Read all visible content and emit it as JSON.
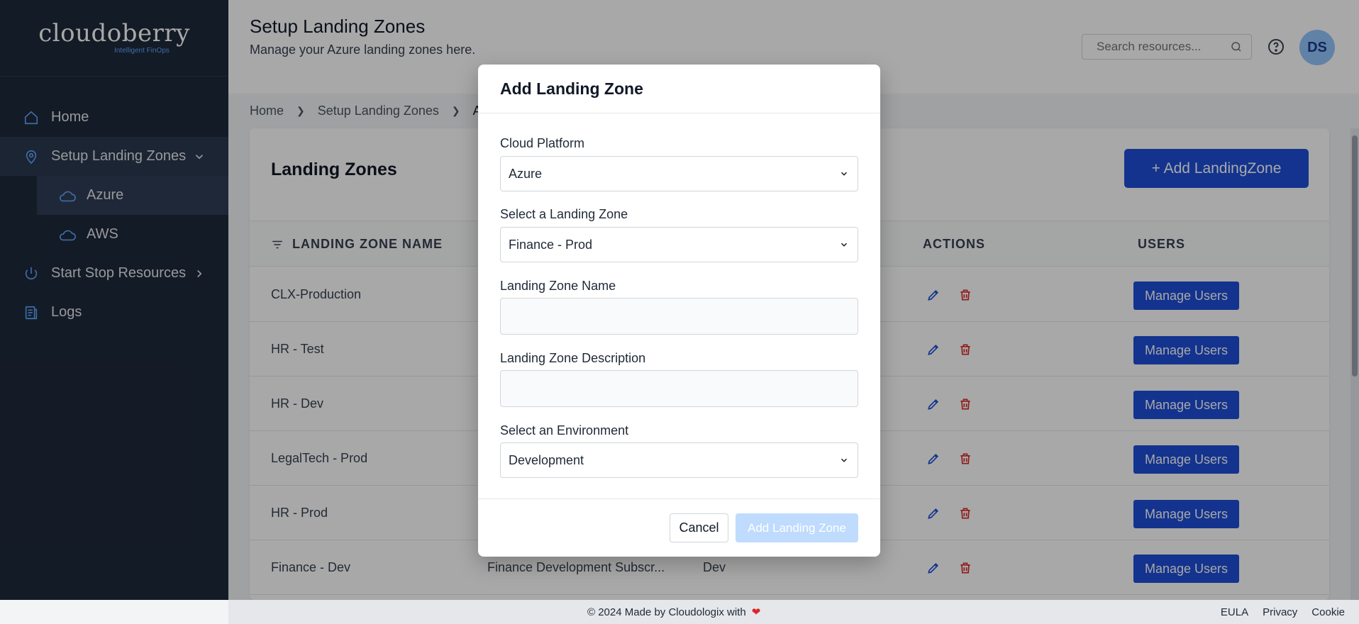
{
  "app": {
    "logo": "cloudoberry",
    "logo_tagline": "Intelligent FinOps"
  },
  "sidebar": {
    "items": [
      {
        "label": "Home",
        "icon": "home-icon"
      },
      {
        "label": "Setup Landing Zones",
        "icon": "map-pin-icon",
        "expanded": true
      },
      {
        "label": "Azure",
        "icon": "cloud-icon",
        "active": true
      },
      {
        "label": "AWS",
        "icon": "cloud-icon"
      },
      {
        "label": "Start Stop Resources",
        "icon": "power-icon"
      },
      {
        "label": "Logs",
        "icon": "logs-icon"
      }
    ]
  },
  "header": {
    "title": "Setup Landing Zones",
    "subtitle": "Manage your Azure landing zones here.",
    "search_placeholder": "Search resources...",
    "avatar_initials": "DS"
  },
  "breadcrumb": {
    "items": [
      "Home",
      "Setup Landing Zones",
      "Azu"
    ]
  },
  "card": {
    "title": "Landing Zones",
    "add_button": "+ Add LandingZone",
    "columns": {
      "name": "LANDING ZONE NAME",
      "actions": "ACTIONS",
      "users": "USERS"
    },
    "rows": [
      {
        "name": "CLX-Production",
        "description": "",
        "environment": ""
      },
      {
        "name": "HR - Test",
        "description": "",
        "environment": ""
      },
      {
        "name": "HR - Dev",
        "description": "",
        "environment": ""
      },
      {
        "name": "LegalTech - Prod",
        "description": "",
        "environment": ""
      },
      {
        "name": "HR - Prod",
        "description": "",
        "environment": ""
      },
      {
        "name": "Finance - Dev",
        "description": "Finance Development Subscr...",
        "environment": "Dev"
      }
    ],
    "manage_users_label": "Manage Users"
  },
  "modal": {
    "title": "Add Landing Zone",
    "cloud_platform_label": "Cloud Platform",
    "cloud_platform_value": "Azure",
    "landing_zone_label": "Select a Landing Zone",
    "landing_zone_value": "Finance - Prod",
    "name_label": "Landing Zone Name",
    "name_value": "",
    "description_label": "Landing Zone Description",
    "description_value": "",
    "environment_label": "Select an Environment",
    "environment_value": "Development",
    "cancel_label": "Cancel",
    "submit_label": "Add Landing Zone"
  },
  "footer": {
    "text": "© 2024 Made by Cloudologix with",
    "links": [
      "EULA",
      "Privacy",
      "Cookie"
    ]
  },
  "colors": {
    "sidebar_bg": "#1e293b",
    "accent": "#1d4ed8",
    "danger": "#dc2626",
    "disabled_button": "#bfdbfe"
  }
}
